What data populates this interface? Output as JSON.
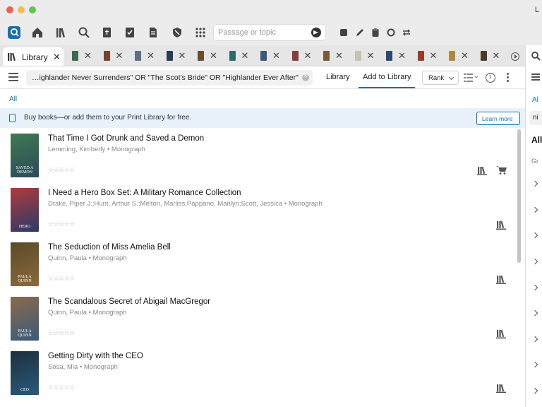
{
  "window": {
    "title_visible": "L"
  },
  "toolbar": {
    "icons": [
      "app-logo-icon",
      "home-icon",
      "library-icon",
      "search-icon",
      "bible-icon",
      "checklist-icon",
      "document-icon",
      "shield-icon",
      "grid-icon",
      "stop-icon",
      "pen-icon",
      "clipboard-icon",
      "circle-icon",
      "sync-icon"
    ],
    "search_placeholder": "Passage or topic"
  },
  "tabs": {
    "library_label": "Library",
    "book_tab_colors": [
      "#3d6a4e",
      "#7a3f2a",
      "#5b6f86",
      "#2c3a55",
      "#6a4b2f",
      "#2e6a6a",
      "#3a5a7a",
      "#8a3b3b",
      "#7a5a3a",
      "#c8c0b0",
      "#2b4a6b",
      "#9a3a2a",
      "#b08a3a",
      "#4a3a2a"
    ]
  },
  "querybar": {
    "query": "…ighlander Never Surrenders\" OR \"The Scot's Bride\" OR  \"Highlander Ever After\"",
    "library_button": "Library",
    "add_button": "Add to Library",
    "rank_label": "Rank"
  },
  "filter": {
    "all_label": "All"
  },
  "banner": {
    "text": "Buy books—or add them to your Print Library for free.",
    "button": "Learn more"
  },
  "results": [
    {
      "title": "That Time I Got Drunk and Saved a Demon",
      "meta": "Lemming, Kimberly • Monograph",
      "stars": "☆☆☆☆☆",
      "cover_text": "SAVED A DEMON",
      "cover_colors": [
        "#3f7a52",
        "#2c4a5a"
      ],
      "has_cart": true
    },
    {
      "title": "I Need a Hero Box Set: A Military Romance Collection",
      "meta": "Drake, Piper J.;Hunt, Arthur S.;Melton, Marliss;Pappano, Marilyn;Scott, Jessica • Monograph",
      "stars": "☆☆☆☆☆",
      "cover_text": "HERO",
      "cover_colors": [
        "#b03a3a",
        "#2a3a6a"
      ],
      "has_cart": false
    },
    {
      "title": "The Seduction of Miss Amelia Bell",
      "meta": "Quinn, Paula • Monograph",
      "stars": "☆☆☆☆☆",
      "cover_text": "PAULA QUINN",
      "cover_colors": [
        "#5a4a2a",
        "#8a6a3a"
      ],
      "has_cart": false
    },
    {
      "title": "The Scandalous Secret of Abigail MacGregor",
      "meta": "Quinn, Paula • Monograph",
      "stars": "☆☆☆☆☆",
      "cover_text": "PAULA QUINN",
      "cover_colors": [
        "#8a6a4a",
        "#3a5a7a"
      ],
      "has_cart": false
    },
    {
      "title": "Getting Dirty with the CEO",
      "meta": "Sosa, Mia • Monograph",
      "stars": "☆☆☆☆☆",
      "cover_text": "CEO",
      "cover_colors": [
        "#1f2f3f",
        "#2a5a7a"
      ],
      "has_cart": false
    }
  ],
  "right_panel": {
    "all_label": "Al",
    "query_fragment": "ni",
    "heading": "All",
    "subheading": "Gr"
  },
  "colors": {
    "accent": "#1b6fa8",
    "banner_bg": "#e9f2fb",
    "chrome": "#ececec"
  }
}
